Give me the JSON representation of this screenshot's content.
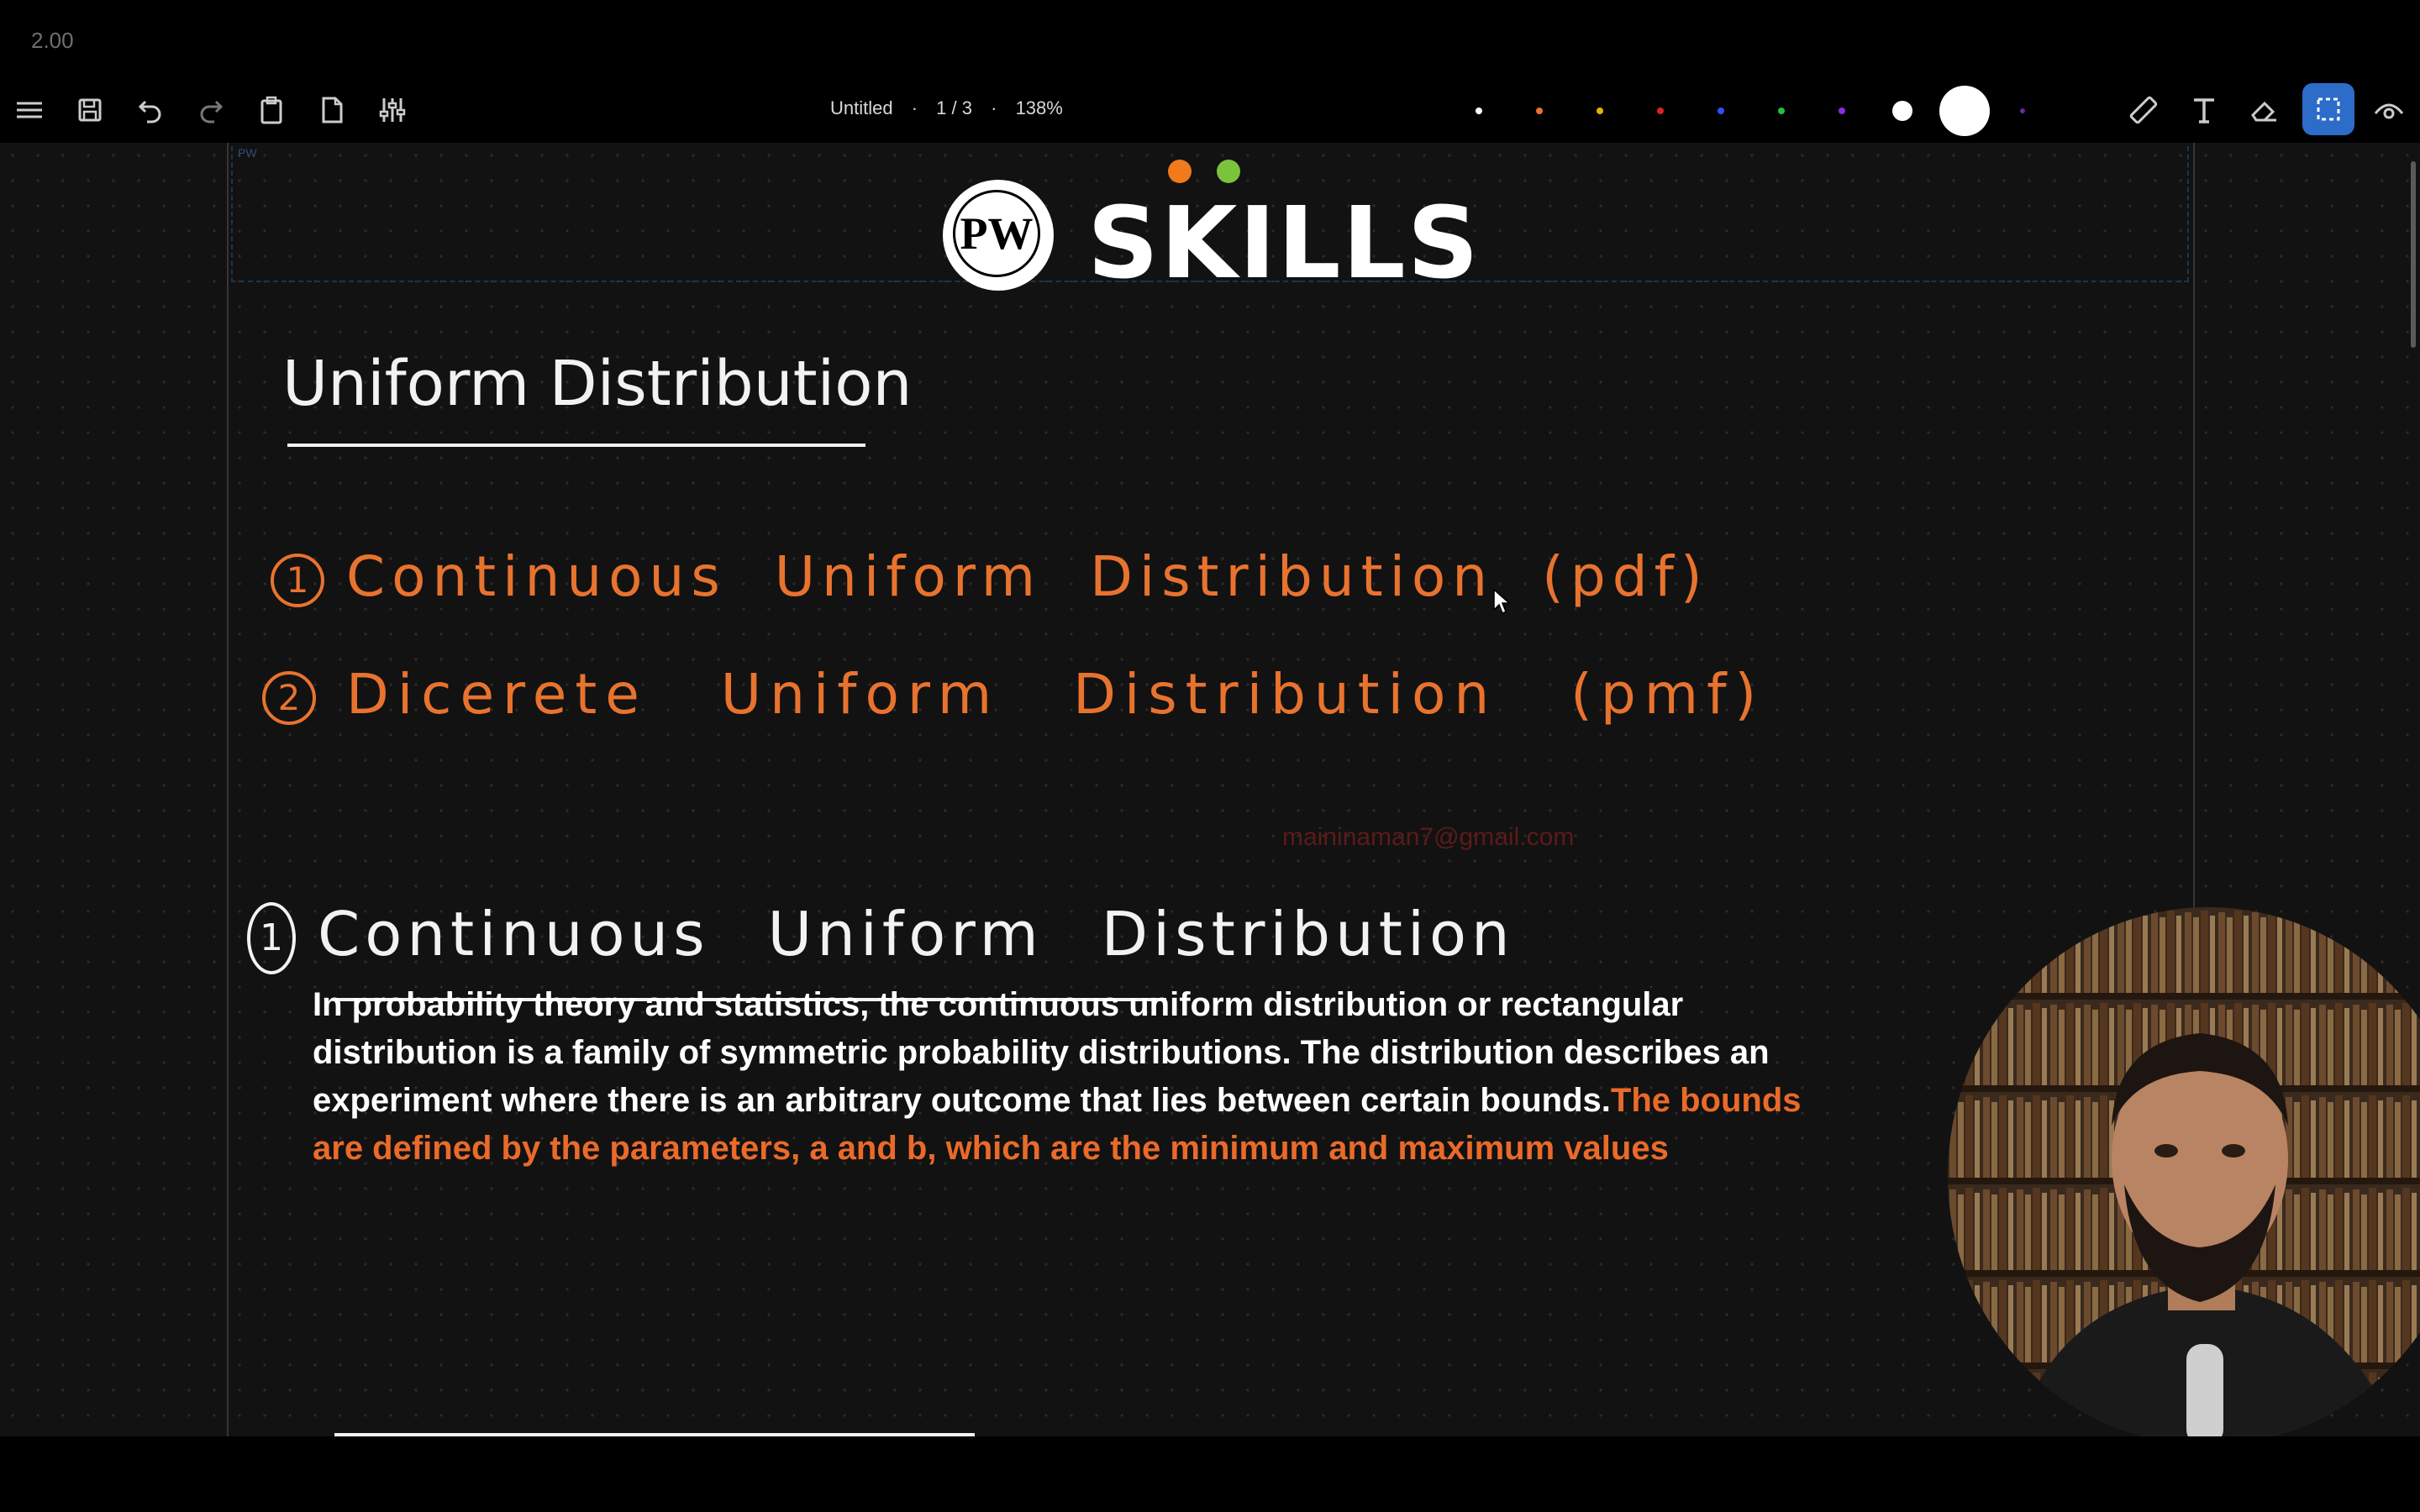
{
  "app": {
    "version": "2.00"
  },
  "toolbar": {
    "doc_title": "Untitled",
    "separator": "·",
    "page_indicator": "1 / 3",
    "zoom": "138%",
    "icons": [
      "menu-icon",
      "save-icon",
      "undo-icon",
      "redo-icon",
      "clipboard-icon",
      "new-page-icon",
      "settings-sliders-icon",
      "ruler-icon",
      "text-tool-icon",
      "eraser-icon",
      "selection-tool-icon",
      "view-eye-icon"
    ],
    "pen_colors": [
      "#ffffff",
      "#e8732e",
      "#e0b400",
      "#e02020",
      "#2f4fff",
      "#20c040",
      "#8a2be2"
    ],
    "stroke_sizes": [
      "small",
      "large"
    ],
    "accent": "#2d6cc9"
  },
  "canvas": {
    "header_label": "PW",
    "logo": {
      "initials": "PW",
      "text": "SKILLS",
      "dot_colors": [
        "#f07a1c",
        "#7cc33c"
      ]
    },
    "title": "Uniform Distribution",
    "list": [
      {
        "num": "1",
        "text": "Continuous Uniform Distribution (pdf)"
      },
      {
        "num": "2",
        "text": "Dicerete Uniform Distribution (pmf)"
      }
    ],
    "watermark": "maininaman7@gmail.com",
    "section_heading": {
      "num": "1",
      "text": "Continuous Uniform Distribution"
    },
    "paragraph": {
      "white": "In probability theory and statistics, the continuous uniform distribution or rectangular distribution is a family of symmetric probability distributions. The distribution describes an experiment where there is an arbitrary outcome that lies between certain bounds.",
      "highlight": "The bounds are defined by the parameters, a and b, which are the minimum and maximum values"
    }
  },
  "colors": {
    "background": "#000000",
    "canvas": "#121212",
    "handwriting_white": "#f2f2f2",
    "handwriting_orange": "#e8732e"
  }
}
